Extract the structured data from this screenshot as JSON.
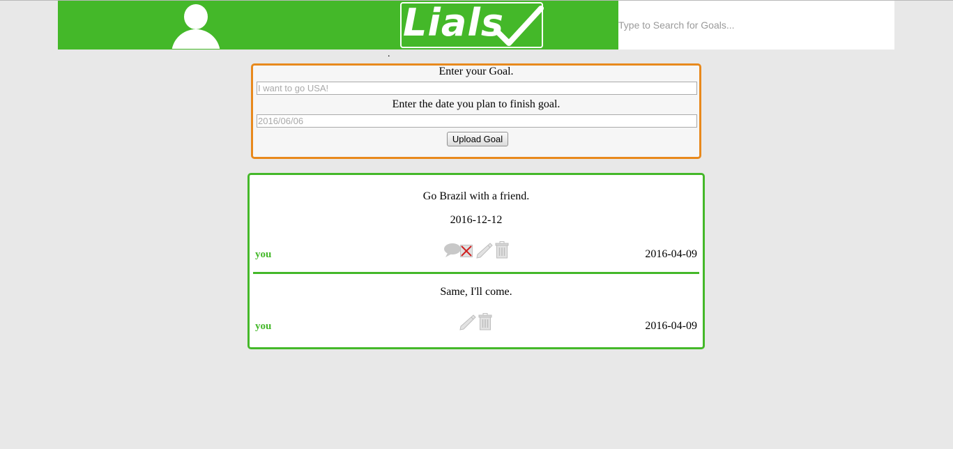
{
  "header": {
    "logo_text": "Lials",
    "avatar_icon": "user-icon",
    "search_placeholder": "Type to Search for Goals...",
    "brand_color": "#44b829"
  },
  "separator_text": ".",
  "goal_form": {
    "goal_label": "Enter your Goal.",
    "goal_placeholder": "I want to go USA!",
    "goal_value": "",
    "date_label": "Enter the date you plan to finish goal.",
    "date_placeholder": "2016/06/06",
    "date_value": "",
    "upload_label": "Upload Goal",
    "border_color": "#e8891c"
  },
  "goal": {
    "text": "Go Brazil with a friend.",
    "target_date": "2016-12-12",
    "author": "you",
    "posted_date": "2016-04-09",
    "actions": [
      "comment-icon",
      "close-icon",
      "pencil-icon",
      "trash-icon"
    ],
    "comments": [
      {
        "text": "Same, I'll come.",
        "author": "you",
        "posted_date": "2016-04-09",
        "actions": [
          "pencil-icon",
          "trash-icon"
        ]
      }
    ]
  }
}
